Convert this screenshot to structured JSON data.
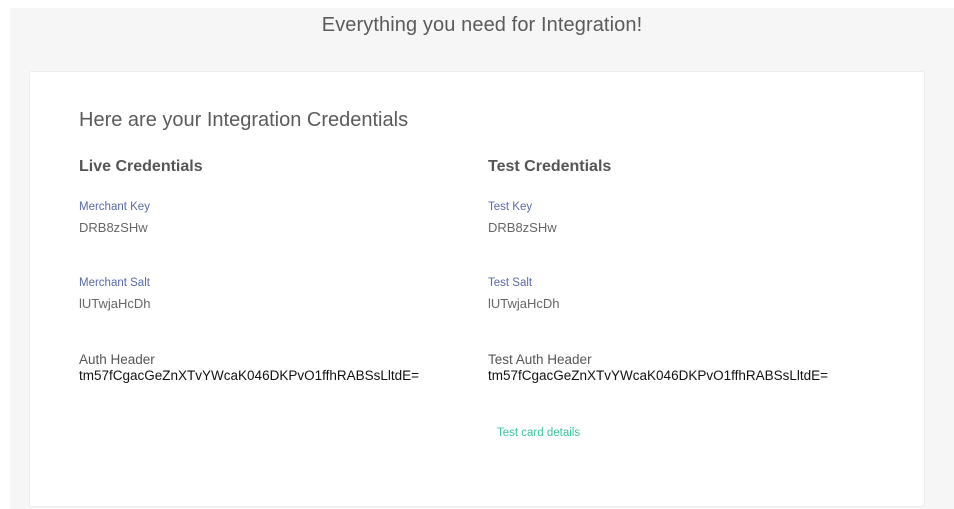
{
  "page": {
    "heading": "Everything you need for Integration!"
  },
  "card": {
    "title": "Here are your Integration Credentials"
  },
  "live": {
    "title": "Live Credentials",
    "key_label": "Merchant Key",
    "key_value": "DRB8zSHw",
    "salt_label": "Merchant Salt",
    "salt_value": "lUTwjaHcDh",
    "auth_label": "Auth Header",
    "auth_value": "tm57fCgacGeZnXTvYWcaK046DKPvO1ffhRABSsLltdE="
  },
  "test": {
    "title": "Test Credentials",
    "key_label": "Test Key",
    "key_value": "DRB8zSHw",
    "salt_label": "Test Salt",
    "salt_value": "lUTwjaHcDh",
    "auth_label": "Test Auth Header",
    "auth_value": "tm57fCgacGeZnXTvYWcaK046DKPvO1ffhRABSsLltdE=",
    "card_details_link": "Test card details"
  },
  "colors": {
    "link": "#3cc3a0",
    "label": "#5a6aa8",
    "background": "#f6f6f6"
  }
}
